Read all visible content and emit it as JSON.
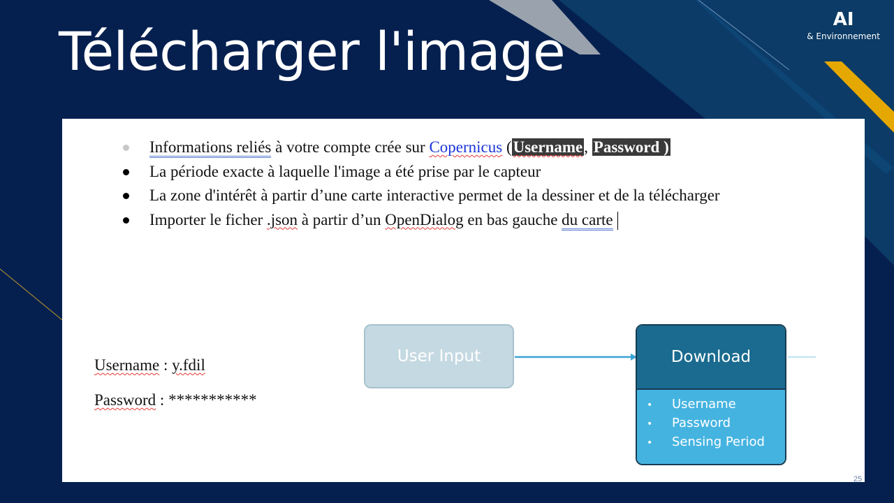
{
  "slide": {
    "title": "Télécharger l'image",
    "brand_main": "AI",
    "brand_sub": "& Environnement",
    "page_number": "25"
  },
  "bullets": {
    "item1": {
      "t1": "Informations reliés",
      "t2": " à votre compte crée sur ",
      "link": "Copernicus",
      "t3": " (",
      "h1": "Username",
      "t4": ", ",
      "h2": "Password )"
    },
    "item2": "La période exacte à laquelle l'image a été prise par le capteur",
    "item3": "La zone d'intérêt à partir d’une carte interactive permet de la dessiner et de la télécharger",
    "item4": {
      "t1": "Importer le ficher ",
      "t2": ".json",
      "t3": " à partir d’un ",
      "t4": "OpenDialog",
      "t5": " en bas gauche ",
      "t6": "du carte"
    }
  },
  "credentials": {
    "user_label": "Username",
    "user_sep": " : ",
    "user_value": "y.fdil",
    "pass_label": "Password",
    "pass_sep": " : ",
    "pass_value": "***********"
  },
  "diagram": {
    "input_label": "User Input",
    "download_title": "Download",
    "download_items": [
      "Username",
      "Password",
      "Sensing Period"
    ],
    "bullet_glyph": "•"
  },
  "colors": {
    "background": "#05204f",
    "accent_yellow": "#e5a800",
    "input_box": "#c5d9e2",
    "download_header": "#1a6b8f",
    "download_body": "#45b3e0"
  }
}
